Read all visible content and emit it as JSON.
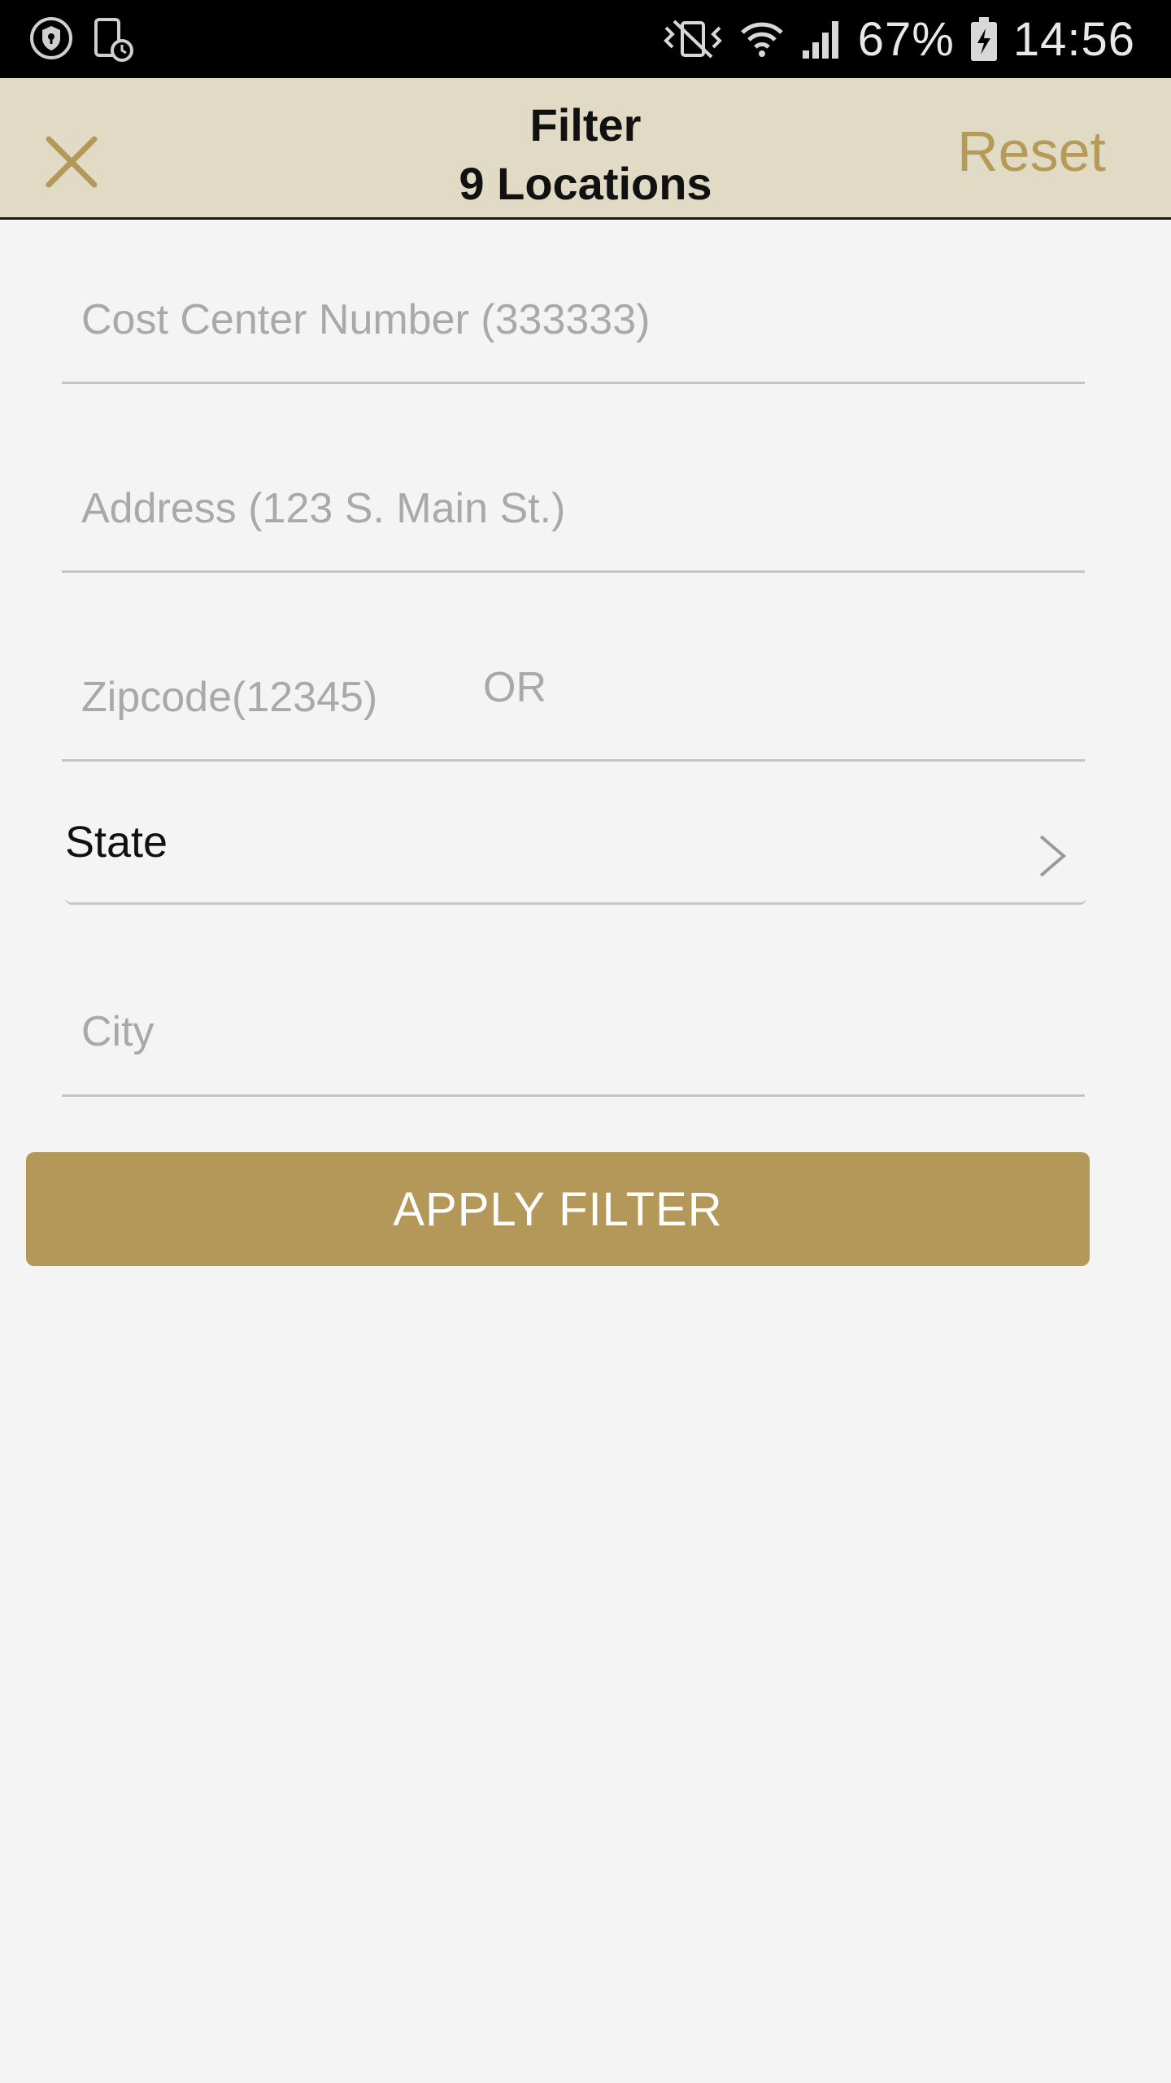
{
  "status_bar": {
    "battery": "67%",
    "time": "14:56",
    "icons": [
      "shield-icon",
      "device-clock-icon",
      "vibrate-icon",
      "wifi-icon",
      "signal-icon",
      "battery-icon"
    ]
  },
  "header": {
    "title": "Filter",
    "subtitle": "9 Locations",
    "close_icon": "close-icon",
    "reset_label": "Reset"
  },
  "form": {
    "cost_center": {
      "value": "",
      "placeholder": "Cost Center Number (333333)"
    },
    "address": {
      "value": "",
      "placeholder": "Address (123 S. Main St.)"
    },
    "zipcode": {
      "value": "",
      "placeholder": "Zipcode(12345)"
    },
    "or_label": "OR",
    "state": {
      "label": "State",
      "icon": "chevron-right-icon"
    },
    "city": {
      "value": "",
      "placeholder": "City"
    }
  },
  "apply_button": {
    "label": "APPLY FILTER"
  },
  "colors": {
    "header_bg": "#e1dac4",
    "accent": "#b49859",
    "background": "#f4f4f4"
  }
}
